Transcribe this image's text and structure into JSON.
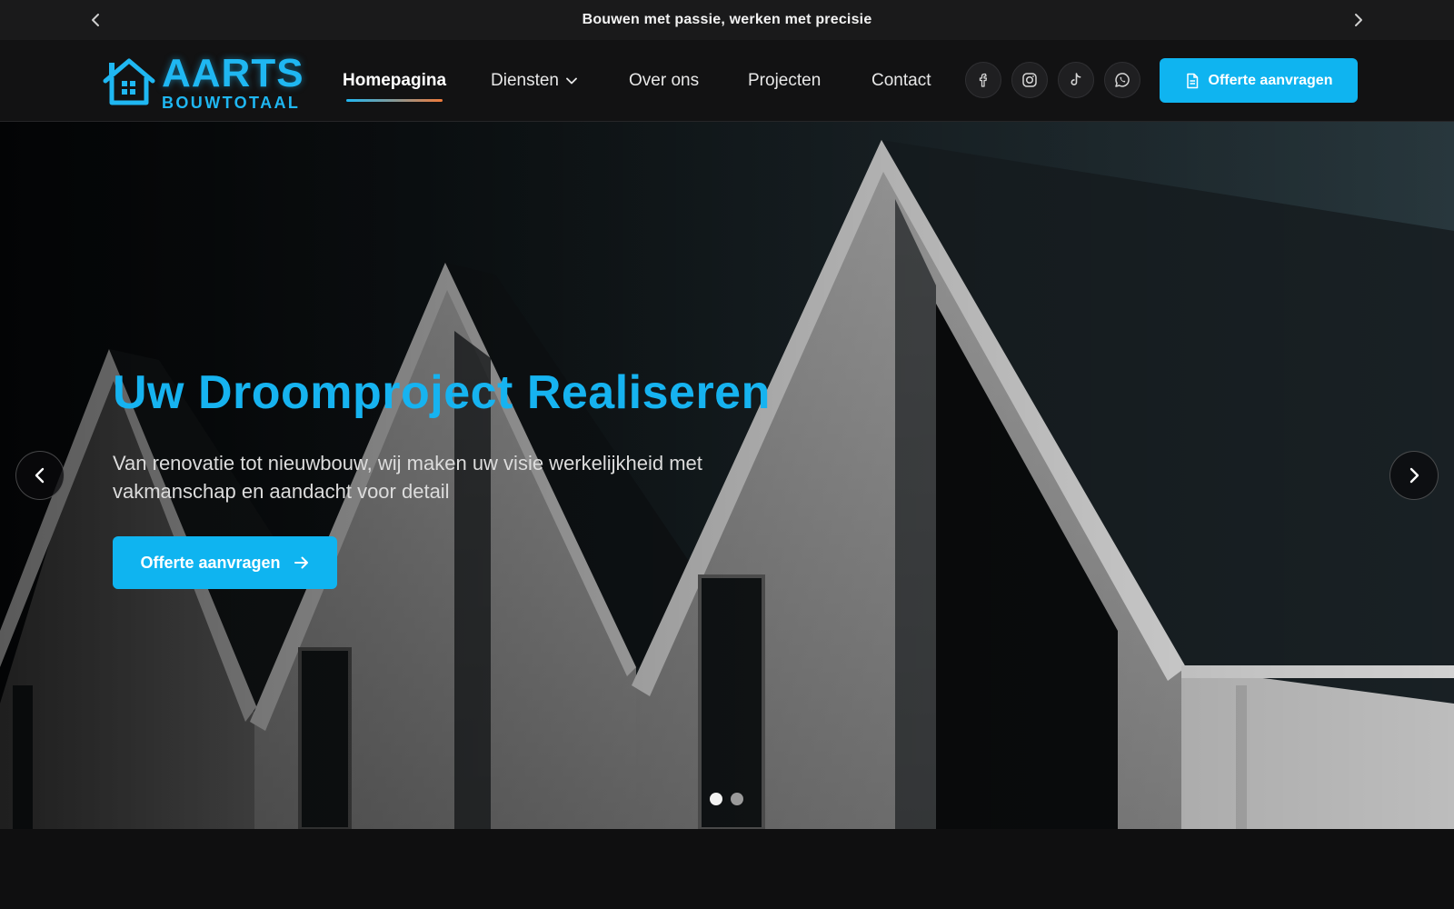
{
  "announcement": {
    "text": "Bouwen met passie, werken met precisie",
    "prev_icon": "chevron-left-icon",
    "next_icon": "chevron-right-icon"
  },
  "logo": {
    "main": "AARTS",
    "sub": "BOUWTOTAAL",
    "icon": "house-icon"
  },
  "nav": {
    "items": [
      {
        "label": "Homepagina",
        "active": true
      },
      {
        "label": "Diensten",
        "has_dropdown": true
      },
      {
        "label": "Over ons"
      },
      {
        "label": "Projecten"
      },
      {
        "label": "Contact"
      }
    ]
  },
  "social": [
    "facebook-icon",
    "instagram-icon",
    "tiktok-icon",
    "whatsapp-icon"
  ],
  "header_cta": {
    "label": "Offerte aanvragen",
    "icon": "document-icon"
  },
  "hero": {
    "title": "Uw Droomproject Realiseren",
    "subtitle": "Van renovatie tot nieuwbouw, wij maken uw visie werkelijkheid met vakmanschap en aandacht voor detail",
    "cta_label": "Offerte aanvragen",
    "cta_icon": "arrow-right-icon",
    "slides_total": 2,
    "active_slide": 1
  },
  "colors": {
    "accent": "#0fb4f0",
    "underline_start": "#1fb7f2",
    "underline_end": "#f07a3a",
    "background": "#0f0f10"
  }
}
